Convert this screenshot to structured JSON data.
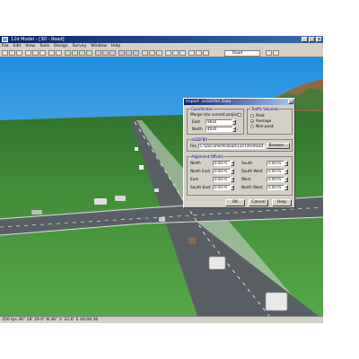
{
  "window": {
    "title": "12d Model - [3D - Road]",
    "minimize": "_",
    "maximize": "□",
    "close": "×"
  },
  "menu": [
    "File",
    "Edit",
    "View",
    "Tools",
    "Design",
    "Survey",
    "Window",
    "Help"
  ],
  "toolbar": {
    "view_combo": "Road"
  },
  "dialog": {
    "title": "Import .ssGDFBA Data",
    "close": "×",
    "coordinates": {
      "title": "Coordinates",
      "merge_label": "Merge into current project",
      "east_label": "East",
      "east_value": "9816",
      "north_label": "North",
      "north_value": "4930"
    },
    "traffic_volumes": {
      "title": "Traffic Volumes",
      "options": [
        "Peak",
        "Average",
        "Non-peak"
      ],
      "selected": "Average"
    },
    "file_section": {
      "title": "ssGDFBA",
      "file_label": "File",
      "file_value": "C:\\Documents\\Road\\12d Files\\Road 1\\Sample Dat",
      "browse": "Browse..."
    },
    "alignment": {
      "title": "Alignment Offsets",
      "rows": [
        {
          "label_left": "North",
          "value_left": "0.00 m",
          "label_right": "South",
          "value_right": "0.00 m"
        },
        {
          "label_left": "North East",
          "value_left": "0.00 m",
          "label_right": "South West",
          "value_right": "0.00 m"
        },
        {
          "label_left": "East",
          "value_left": "0.00 m",
          "label_right": "West",
          "value_right": "0.00 m"
        },
        {
          "label_left": "South East",
          "value_left": "0.00 m",
          "label_right": "North West",
          "value_right": "0.00 m"
        }
      ]
    },
    "buttons": {
      "ok": "OK",
      "cancel": "Cancel",
      "help": "Help"
    }
  },
  "statusbar": {
    "text": "356 fps     36° 18' 29.6\" N  36° 3' 22.6\" E     00:04:36"
  }
}
